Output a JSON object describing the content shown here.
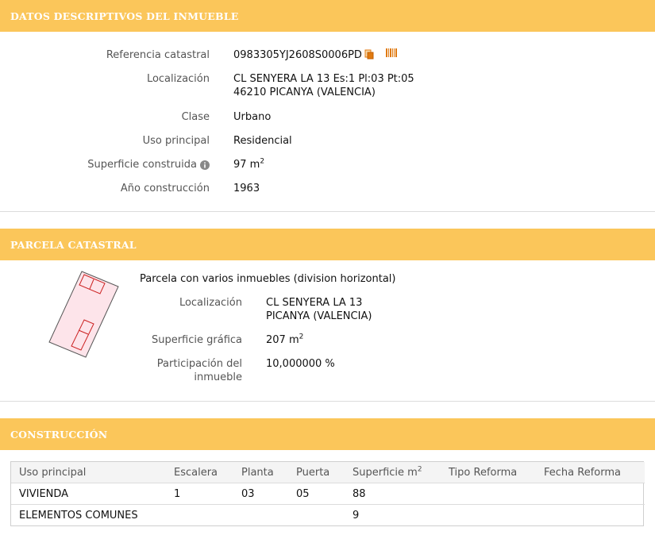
{
  "section1": {
    "title": "DATOS DESCRIPTIVOS DEL INMUEBLE",
    "ref_label": "Referencia catastral",
    "ref_value": "0983305YJ2608S0006PD",
    "loc_label": "Localización",
    "loc_line1": "CL SENYERA LA 13 Es:1 Pl:03 Pt:05",
    "loc_line2": "46210 PICANYA (VALENCIA)",
    "clase_label": "Clase",
    "clase_value": "Urbano",
    "uso_label": "Uso principal",
    "uso_value": "Residencial",
    "sup_label": "Superficie construida",
    "sup_value": "97 m",
    "sup_unit_exp": "2",
    "anio_label": "Año construcción",
    "anio_value": "1963"
  },
  "section2": {
    "title": "PARCELA CATASTRAL",
    "desc": "Parcela con varios inmuebles (division horizontal)",
    "loc_label": "Localización",
    "loc_line1": "CL SENYERA LA 13",
    "loc_line2": "PICANYA (VALENCIA)",
    "sup_label": "Superficie gráfica",
    "sup_value": "207 m",
    "sup_unit_exp": "2",
    "part_label_1": "Participación del",
    "part_label_2": "inmueble",
    "part_value": "10,000000 %"
  },
  "section3": {
    "title": "CONSTRUCCIÓN",
    "headers": [
      "Uso principal",
      "Escalera",
      "Planta",
      "Puerta",
      "Superficie m",
      "Tipo Reforma",
      "Fecha Reforma"
    ],
    "sup_header_exp": "2",
    "rows": [
      [
        "VIVIENDA",
        "1",
        "03",
        "05",
        "88",
        "",
        ""
      ],
      [
        "ELEMENTOS COMUNES",
        "",
        "",
        "",
        "9",
        "",
        ""
      ]
    ]
  },
  "icons": {
    "copy": "copy-icon",
    "barcode": "barcode-icon",
    "info": "info-icon"
  },
  "colors": {
    "header": "#fbc65a",
    "accent": "#e07a10",
    "parcel_fill": "#fde4ea",
    "parcel_stroke": "#cc2222"
  }
}
